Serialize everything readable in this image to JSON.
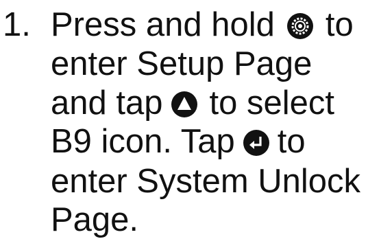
{
  "instruction": {
    "number": "1.",
    "line1_a": "Press and hold",
    "line1_b": "to",
    "line2": "enter Setup Page",
    "line3_a": "and tap",
    "line3_b": "to select",
    "line4_a": "B9 icon. Tap",
    "line4_b": "to",
    "line5": "enter System Unlock",
    "line6": "Page."
  },
  "icons": {
    "setup": "gear-button-icon",
    "up": "up-arrow-button-icon",
    "enter": "enter-return-button-icon"
  },
  "colors": {
    "text": "#111111",
    "background": "#ffffff"
  }
}
